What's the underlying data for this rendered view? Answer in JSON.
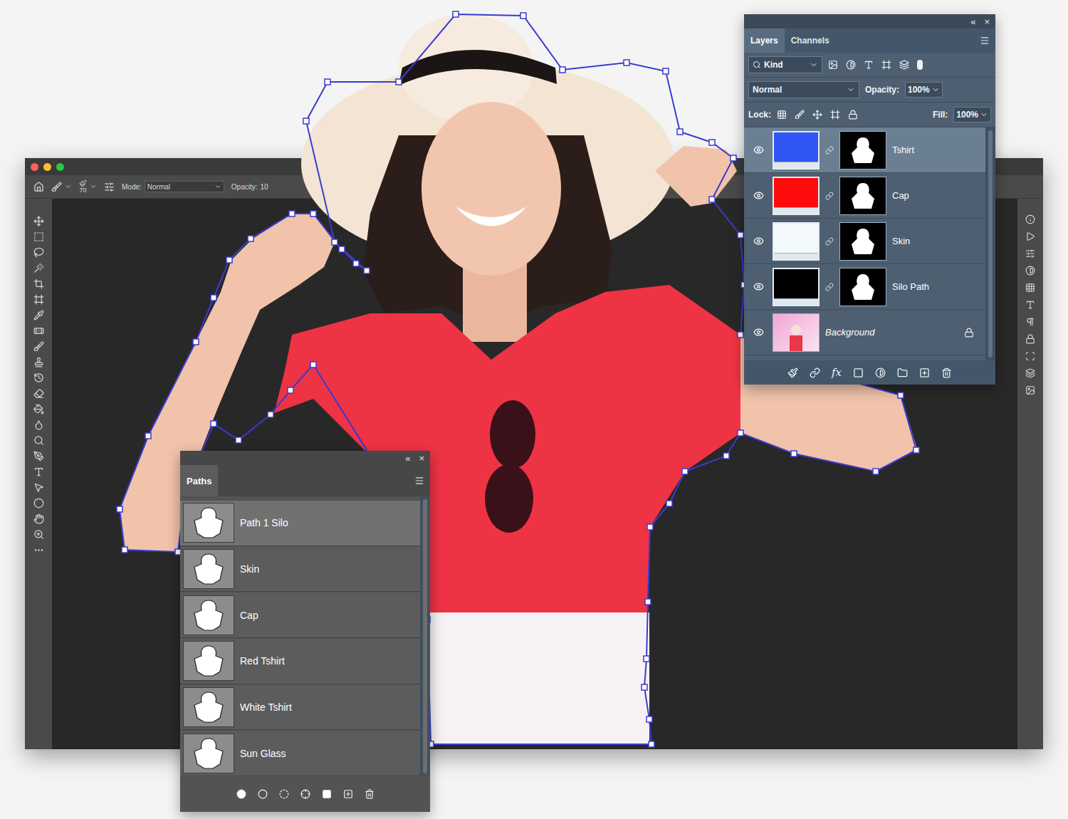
{
  "options_bar": {
    "brush_size": "70",
    "mode_label": "Mode:",
    "mode": "Normal",
    "opacity_label": "Opacity:",
    "opacity": "10"
  },
  "layers_panel": {
    "collapse": "«",
    "close": "×",
    "tabs": [
      {
        "label": "Layers",
        "selected": true
      },
      {
        "label": "Channels",
        "selected": false
      }
    ],
    "filter": "Kind",
    "blend_mode": "Normal",
    "opacity_label": "Opacity:",
    "opacity": "100%",
    "lock_label": "Lock:",
    "fill_label": "Fill:",
    "fill": "100%",
    "fx": "fx",
    "layers": [
      {
        "name": "Tshirt",
        "selected": true,
        "visible": true,
        "kind": "fill",
        "color": "#2f55f5",
        "italic": false,
        "locked": false
      },
      {
        "name": "Cap",
        "selected": false,
        "visible": true,
        "kind": "fill",
        "color": "#fe0b0b",
        "italic": false,
        "locked": false
      },
      {
        "name": "Skin",
        "selected": false,
        "visible": true,
        "kind": "fill",
        "color": "#f3f8fb",
        "italic": false,
        "locked": false
      },
      {
        "name": "Silo Path",
        "selected": false,
        "visible": true,
        "kind": "fill",
        "color": "#000000",
        "italic": false,
        "locked": false
      },
      {
        "name": "Background",
        "selected": false,
        "visible": true,
        "kind": "photo",
        "color": "#f2a6d6",
        "italic": true,
        "locked": true
      }
    ]
  },
  "paths_panel": {
    "collapse": "«",
    "close": "×",
    "tabs": [
      {
        "label": "Paths",
        "selected": true
      }
    ],
    "paths": [
      {
        "name": "Path 1 Silo",
        "selected": true
      },
      {
        "name": "Skin",
        "selected": false
      },
      {
        "name": "Cap",
        "selected": false
      },
      {
        "name": "Red Tshirt",
        "selected": false
      },
      {
        "name": "White Tshirt",
        "selected": false
      },
      {
        "name": "Sun Glass",
        "selected": false
      }
    ]
  }
}
